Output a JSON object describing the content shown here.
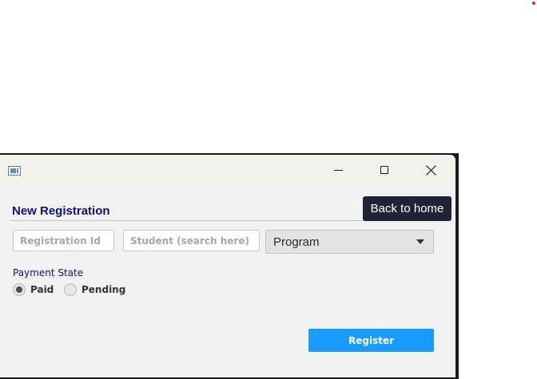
{
  "window": {
    "controls": {
      "minimize_icon": "minimize-icon",
      "maximize_icon": "maximize-icon",
      "close_icon": "close-icon"
    }
  },
  "form": {
    "heading": "New Registration",
    "registration_id": {
      "placeholder": "Registration Id",
      "value": ""
    },
    "student": {
      "placeholder": "Student (search here)",
      "value": ""
    },
    "program": {
      "selected": "Program"
    },
    "payment": {
      "label": "Payment State",
      "options": [
        {
          "label": "Paid",
          "checked": true
        },
        {
          "label": "Pending",
          "checked": false
        }
      ]
    },
    "register_label": "Register"
  },
  "tooltip": {
    "text": "Back to home"
  },
  "colors": {
    "heading": "#0f0f7f",
    "accent_button": "#1a9bff",
    "tooltip_bg": "#1e2436",
    "indicator_dot": "#d9262e"
  }
}
